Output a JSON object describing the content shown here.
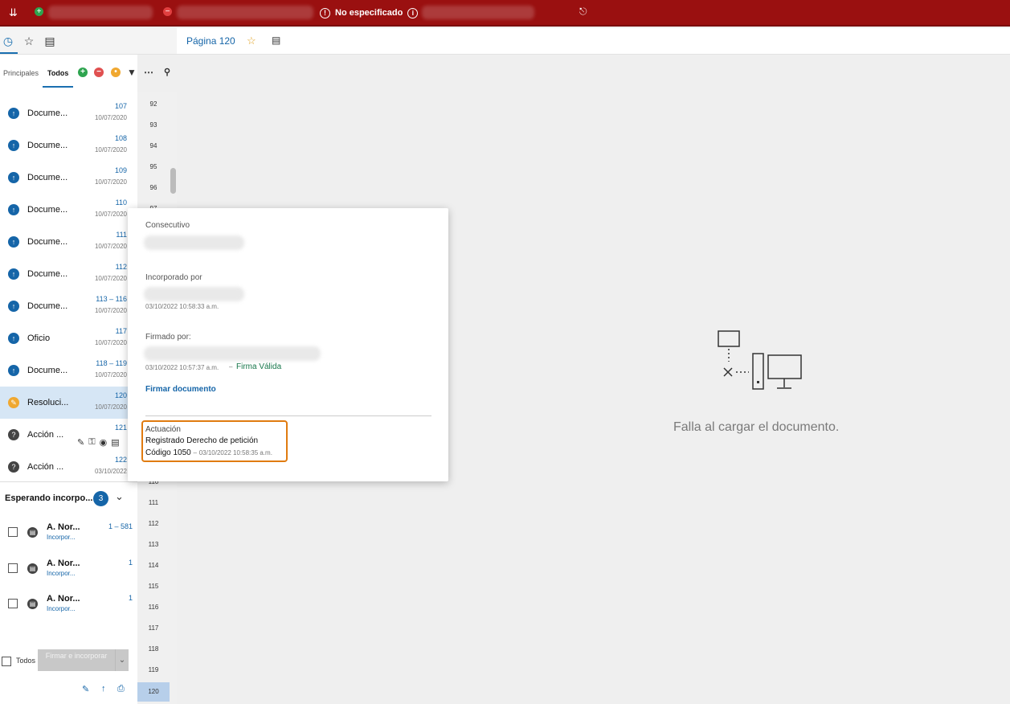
{
  "topbar": {
    "status": "No especificado"
  },
  "sidebar": {
    "tabs": [
      "Principales",
      "Todos"
    ],
    "documents": [
      {
        "title": "Docume...",
        "num": "107",
        "date": "10/07/2020",
        "icon": "upload-icon"
      },
      {
        "title": "Docume...",
        "num": "108",
        "date": "10/07/2020",
        "icon": "upload-icon"
      },
      {
        "title": "Docume...",
        "num": "109",
        "date": "10/07/2020",
        "icon": "upload-icon"
      },
      {
        "title": "Docume...",
        "num": "110",
        "date": "10/07/2020",
        "icon": "upload-icon"
      },
      {
        "title": "Docume...",
        "num": "111",
        "date": "10/07/2020",
        "icon": "upload-icon"
      },
      {
        "title": "Docume...",
        "num": "112",
        "date": "10/07/2020",
        "icon": "upload-icon"
      },
      {
        "title": "Docume...",
        "num": "113 – 116",
        "date": "10/07/2020",
        "icon": "upload-icon"
      },
      {
        "title": "Oficio",
        "num": "117",
        "date": "10/07/2020",
        "icon": "upload-icon"
      },
      {
        "title": "Docume...",
        "num": "118 – 119",
        "date": "10/07/2020",
        "icon": "upload-icon"
      },
      {
        "title": "Resoluci...",
        "num": "120",
        "date": "10/07/2020",
        "icon": "signature-icon"
      },
      {
        "title": "Acción ...",
        "num": "121",
        "date": "",
        "icon": "question-icon"
      },
      {
        "title": "Acción ...",
        "num": "122",
        "date": "03/10/2022",
        "icon": "question-icon"
      }
    ],
    "waiting": {
      "label": "Esperando incorpo...",
      "count": "3",
      "items": [
        {
          "title": "A. Nor...",
          "sub": "Incorpor...",
          "num": "1 – 581"
        },
        {
          "title": "A. Nor...",
          "sub": "Incorpor...",
          "num": "1"
        },
        {
          "title": "A. Nor...",
          "sub": "Incorpor...",
          "num": "1"
        }
      ]
    },
    "footer": {
      "todos_label": "Todos",
      "sign_button": "Firmar e incorporar"
    }
  },
  "page_numbers": [
    "92",
    "93",
    "94",
    "95",
    "96",
    "97",
    "110",
    "111",
    "112",
    "113",
    "114",
    "115",
    "116",
    "117",
    "118",
    "119",
    "120"
  ],
  "main": {
    "page_title": "Página 120",
    "error_message": "Falla al cargar el documento."
  },
  "popup": {
    "consecutivo_label": "Consecutivo",
    "incorporado_label": "Incorporado por",
    "incorporado_date": "03/10/2022 10:58:33 a.m.",
    "firmado_label": "Firmado por:",
    "firmado_date": "03/10/2022 10:57:37 a.m.",
    "firma_valida": "Firma Válida",
    "sign_link": "Firmar documento",
    "actuacion_label": "Actuación",
    "actuacion_value": "Registrado Derecho de petición",
    "codigo": "Código 1050",
    "actuacion_date": "03/10/2022 10:58:35 a.m."
  }
}
